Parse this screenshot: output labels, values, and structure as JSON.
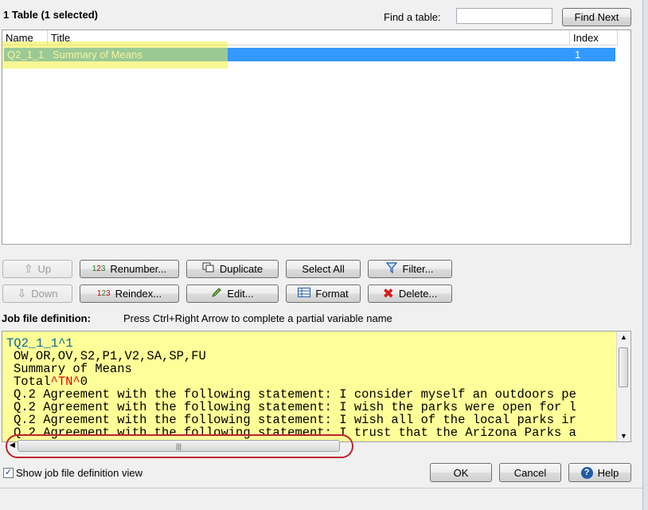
{
  "header": {
    "table_count": "1 Table  (1 selected)",
    "find_label": "Find a table:",
    "find_value": "",
    "find_next": "Find Next"
  },
  "table": {
    "columns": [
      "Name",
      "Title",
      "Index"
    ],
    "rows": [
      {
        "name": "Q2_1_1",
        "title": "Summary of Means",
        "index": "1"
      }
    ]
  },
  "buttons": {
    "up": "Up",
    "down": "Down",
    "renumber": "Renumber...",
    "reindex": "Reindex...",
    "duplicate": "Duplicate",
    "edit": "Edit...",
    "select_all": "Select All",
    "format": "Format",
    "filter": "Filter...",
    "delete": "Delete...",
    "ok": "OK",
    "cancel": "Cancel",
    "help": "Help"
  },
  "job": {
    "label": "Job file definition:",
    "hint": "Press Ctrl+Right Arrow to complete a partial variable name",
    "lines": [
      "TQ2_1_1^1",
      "OW,OR,OV,S2,P1,V2,SA,SP,FU",
      "Summary of Means",
      "Q.2 Agreement with the following statement: I consider myself an outdoors pe",
      "Q.2 Agreement with the following statement: I wish the parks were open for l",
      "Q.2 Agreement with the following statement: I wish all of the local parks ir",
      "Q.2 Agreement with the following statement: I trust that the Arizona Parks a"
    ],
    "total_prefix": "Total",
    "total_marker": "^TN^",
    "total_suffix": "0"
  },
  "options": {
    "show_job_view": "Show job file definition view",
    "show_job_view_checked": "✓"
  },
  "colors": {
    "selection": "#3399ff",
    "code_bg": "#ffff99",
    "highlight_circle": "#c0222f"
  }
}
